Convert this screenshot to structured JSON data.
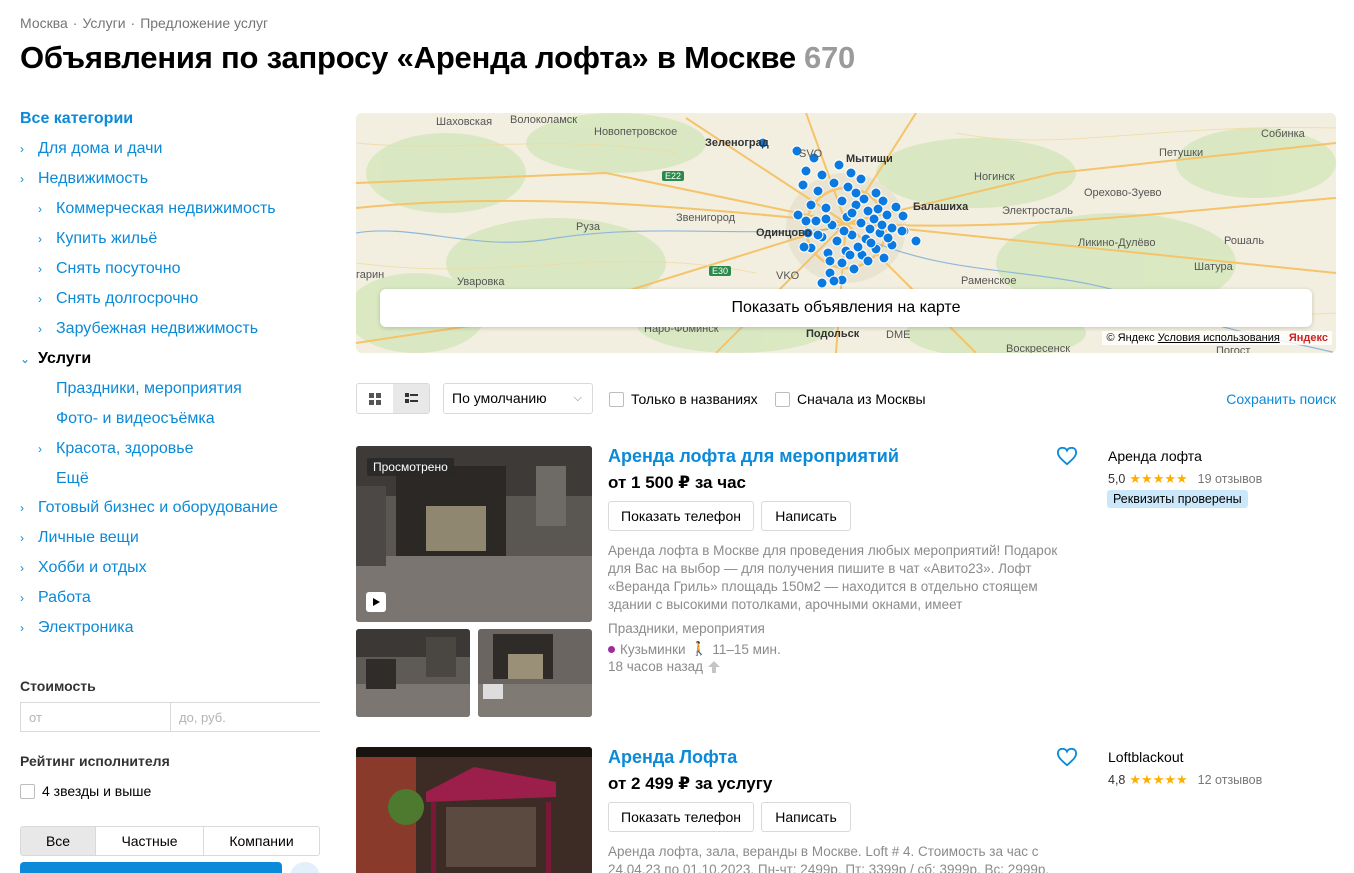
{
  "breadcrumb": [
    "Москва",
    "Услуги",
    "Предложение услуг"
  ],
  "breadcrumb_sep": "·",
  "title": "Объявления по запросу «Аренда лофта» в Москве",
  "title_count": "670",
  "sidebar": {
    "all_label": "Все категории",
    "items": [
      {
        "label": "Для дома и дачи"
      },
      {
        "label": "Недвижимость"
      },
      {
        "label": "Коммерческая недвижимость"
      },
      {
        "label": "Купить жильё"
      },
      {
        "label": "Снять посуточно"
      },
      {
        "label": "Снять долгосрочно"
      },
      {
        "label": "Зарубежная недвижимость"
      },
      {
        "label": "Услуги"
      },
      {
        "label": "Праздники, мероприятия"
      },
      {
        "label": "Фото- и видеосъёмка"
      },
      {
        "label": "Красота, здоровье"
      },
      {
        "label": "Ещё"
      },
      {
        "label": "Готовый бизнес и оборудование"
      },
      {
        "label": "Личные вещи"
      },
      {
        "label": "Хобби и отдых"
      },
      {
        "label": "Работа"
      },
      {
        "label": "Электроника"
      }
    ],
    "price_label": "Стоимость",
    "price_from_placeholder": "от",
    "price_to_placeholder": "до, руб.",
    "rating_label": "Рейтинг исполнителя",
    "rating_option": "4 звезды и выше",
    "seller_types": [
      "Все",
      "Частные",
      "Компании"
    ]
  },
  "map": {
    "labels": [
      "Шаховская",
      "Волоколамск",
      "Новопетровское",
      "Зеленоград",
      "SVO",
      "Мытищи",
      "Собинка",
      "Петушки",
      "Ногинск",
      "Орехово-Зуево",
      "Балашиха",
      "Электросталь",
      "Звенигород",
      "Руза",
      "Одинцово",
      "Ликино-Дулёво",
      "Рошаль",
      "Шатура",
      "гарин",
      "Уваровка",
      "VKO",
      "Раменское",
      "Наро-Фоминск",
      "Подольск",
      "DME",
      "Воскресенск",
      "Погост"
    ],
    "roads": [
      "E22",
      "E30"
    ],
    "show_button": "Показать объявления на карте",
    "copyright": "© Яндекс",
    "terms": "Условия использования",
    "logo": "Яндекс"
  },
  "toolbar": {
    "sort": "По умолчанию",
    "only_titles": "Только в названиях",
    "moscow_first": "Сначала из Москвы",
    "save_search": "Сохранить поиск"
  },
  "listings": [
    {
      "badge": "Просмотрено",
      "title": "Аренда лофта для мероприятий",
      "price": "от 1 500 ₽ за час",
      "phone_btn": "Показать телефон",
      "write_btn": "Написать",
      "description": "Аренда лофта в Москве для проведения любых мероприятий! Подарок для Вас на выбор — для получения пишите в чат «Авито23». Лофт «Веранда Гриль» площадь 150м2 — находится в отдельно стоящем здании с высокими потолками, арочными окнами, имеет",
      "category": "Праздники, мероприятия",
      "metro": "Кузьминки",
      "walk": "11–15 мин.",
      "time": "18 часов назад",
      "seller": "Аренда лофта",
      "rating": "5,0",
      "stars": "★★★★★",
      "reviews": "19 отзывов",
      "verified": "Реквизиты проверены"
    },
    {
      "title": "Аренда Лофта",
      "price": "от 2 499 ₽ за услугу",
      "phone_btn": "Показать телефон",
      "write_btn": "Написать",
      "description": "Аренда лофта, зала, веранды в Москве. Loft # 4. Стоимость за час с 24.04.23 по 01.10.2023. Пн-чт: 2499р. Пт: 3399р / сб: 3999р. Вс: 2999р.",
      "seller": "Loftblackout",
      "rating": "4,8",
      "stars": "★★★★★",
      "reviews": "12 отзывов"
    }
  ],
  "colors": {
    "link": "#0a8ad8",
    "marker": "#0a7ae0",
    "star": "#ffae00",
    "badge": "#cbe8fb"
  }
}
